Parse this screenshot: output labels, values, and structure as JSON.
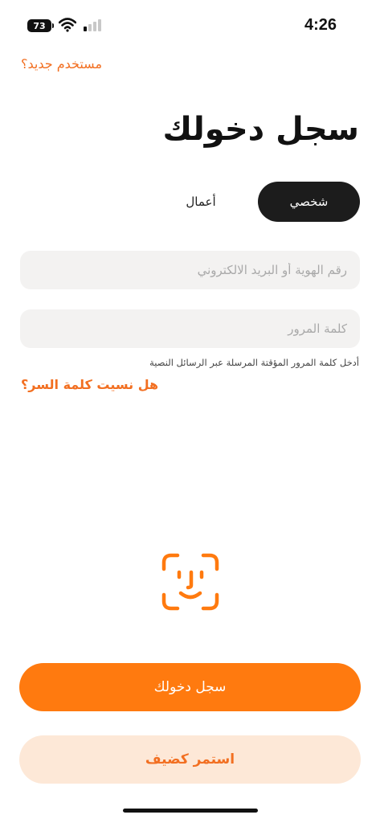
{
  "status_bar": {
    "battery_level": "73",
    "time": "4:26"
  },
  "header": {
    "new_user_link": "مستخدم جديد؟",
    "title": "سجل دخولك"
  },
  "tabs": [
    {
      "label": "شخصي",
      "selected": true
    },
    {
      "label": "أعمال",
      "selected": false
    }
  ],
  "form": {
    "id_placeholder": "رقم الهوية أو البريد الالكتروني",
    "password_placeholder": "كلمة المرور",
    "password_hint": "أدخل كلمة المرور المؤقتة المرسلة عبر الرسائل النصية",
    "forgot_password": "هل نسيت كلمة السر؟"
  },
  "actions": {
    "login_label": "سجل دخولك",
    "guest_label": "استمر كضيف"
  },
  "colors": {
    "accent": "#ff7a0f",
    "accent_text": "#f26f21",
    "guest_bg": "#fde8d7",
    "selected_tab_bg": "#1c1c1c"
  }
}
